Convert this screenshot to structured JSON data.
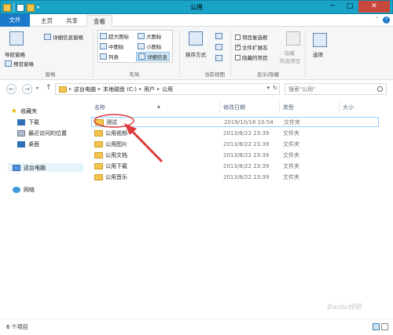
{
  "window": {
    "title": "公用",
    "minimize": "─",
    "maximize": "□",
    "close": "✕"
  },
  "tabs": {
    "file": "文件",
    "home": "主页",
    "share": "共享",
    "view": "查看"
  },
  "ribbon": {
    "nav_pane": "导航窗格",
    "preview_pane": "预览窗格",
    "details_pane": "详细信息窗格",
    "group_panes": "窗格",
    "layout": {
      "extra_large": "超大图标",
      "large": "大图标",
      "medium": "中图标",
      "small": "小图标",
      "list": "列表",
      "details": "详细信息"
    },
    "group_layout": "布局",
    "sort_by": "排序方式",
    "group_current_view": "当前视图",
    "item_checkboxes": "项目复选框",
    "file_extensions": "文件扩展名",
    "hidden_items": "隐藏的项目",
    "hide_selected_1": "隐藏",
    "hide_selected_2": "所选项目",
    "group_show_hide": "显示/隐藏",
    "options": "选项"
  },
  "address": {
    "crumbs": [
      "这台电脑",
      "本地磁盘 (C:)",
      "用户",
      "公用"
    ],
    "search_placeholder": "搜索\"公用\""
  },
  "nav": {
    "favorites": "收藏夹",
    "downloads": "下载",
    "recent": "最近访问的位置",
    "desktop": "桌面",
    "this_pc": "这台电脑",
    "network": "网络"
  },
  "columns": {
    "name": "名称",
    "date": "修改日期",
    "type": "类型",
    "size": "大小"
  },
  "files": [
    {
      "name": "测试",
      "date": "2019/10/18 10:54",
      "type": "文件夹"
    },
    {
      "name": "公用视频",
      "date": "2013/8/22 23:39",
      "type": "文件夹"
    },
    {
      "name": "公用图片",
      "date": "2013/8/22 23:39",
      "type": "文件夹"
    },
    {
      "name": "公用文档",
      "date": "2013/8/22 23:39",
      "type": "文件夹"
    },
    {
      "name": "公用下载",
      "date": "2013/8/22 23:39",
      "type": "文件夹"
    },
    {
      "name": "公用音乐",
      "date": "2013/8/22 23:39",
      "type": "文件夹"
    }
  ],
  "status": {
    "count": "6 个项目"
  },
  "watermark": "Baidu经验",
  "annotation_color": "#e03a3a"
}
